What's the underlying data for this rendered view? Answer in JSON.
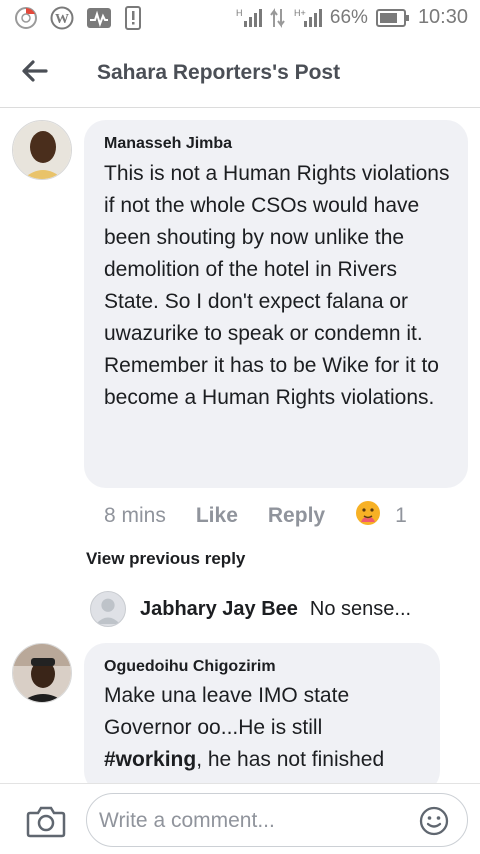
{
  "status_bar": {
    "battery": "66%",
    "time": "10:30",
    "icons_left": [
      "chrome-icon",
      "wordpress-icon",
      "activity-icon",
      "sim-alert-icon"
    ],
    "icons_right": [
      "signal-h-icon",
      "data-arrows-icon",
      "signal-h-plus-icon",
      "battery-icon"
    ]
  },
  "header": {
    "title": "Sahara Reporters's Post",
    "back_icon": "arrow-left-icon"
  },
  "comments": [
    {
      "author": "Manasseh Jimba",
      "body": "This is not a Human Rights violations if not the whole CSOs would have been shouting by now unlike the demolition of the hotel in Rivers State. So I don't expect falana or uwazurike to speak or condemn it. Remember it has to be Wike for it to become a Human Rights violations.",
      "time": "8 mins",
      "like": "Like",
      "reply": "Reply",
      "reaction_icon": "care-reaction-icon",
      "reaction_count": "1"
    },
    {
      "author": "Oguedoihu Chigozirim",
      "body_part1": "Make una leave IMO state Governor oo...He is still ",
      "body_hashtag": "#working",
      "body_part2": ", he has not finished"
    }
  ],
  "view_previous": "View previous reply",
  "reply_preview": {
    "name": "Jabhary Jay Bee",
    "snippet": "No sense..."
  },
  "composer": {
    "placeholder": "Write a comment...",
    "camera_icon": "camera-icon",
    "emoji_icon": "smiley-icon"
  }
}
